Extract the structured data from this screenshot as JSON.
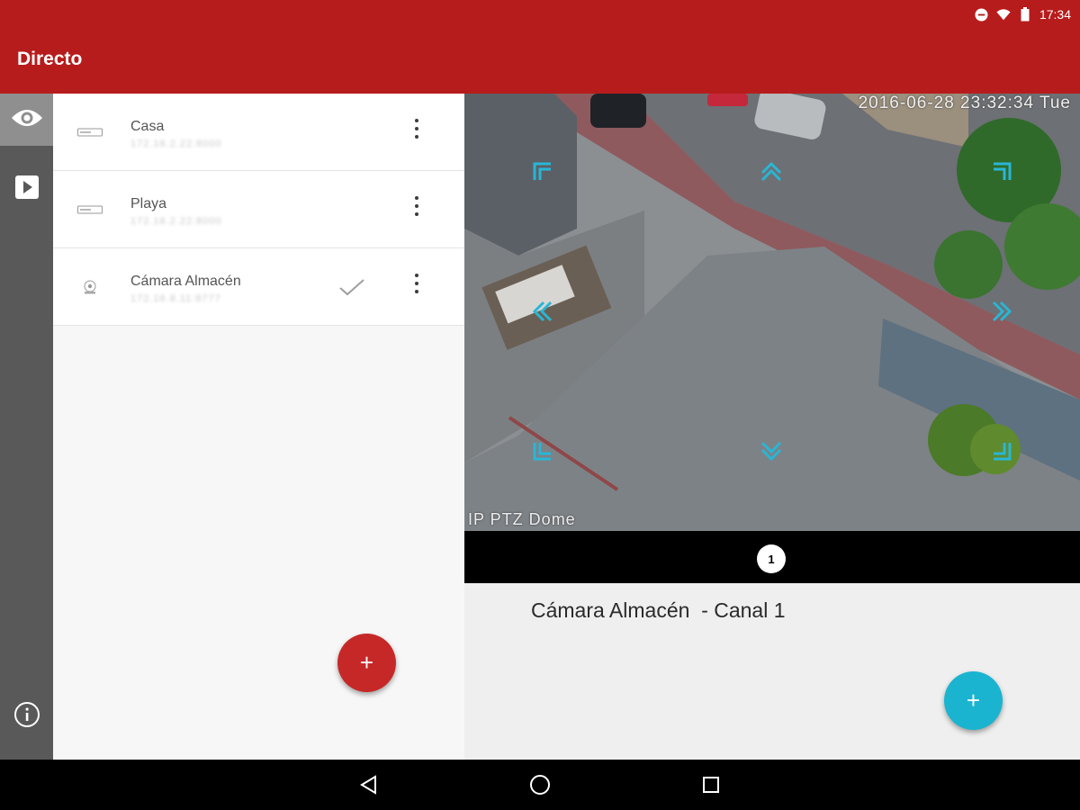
{
  "status_bar": {
    "time": "17:34",
    "icons": [
      "do-not-disturb-icon",
      "wifi-icon",
      "battery-icon"
    ]
  },
  "app_bar": {
    "title": "Directo",
    "color": "#b71c1c"
  },
  "nav_rail": {
    "items": [
      {
        "icon": "eye-icon",
        "active": true
      },
      {
        "icon": "play-icon",
        "active": false
      },
      {
        "icon": "info-icon",
        "active": false
      }
    ]
  },
  "device_list": [
    {
      "name": "Casa",
      "address": "172.16.2.22:8000",
      "icon": "dvr-icon",
      "selected": false
    },
    {
      "name": "Playa",
      "address": "172.16.2.22:8000",
      "icon": "dvr-icon",
      "selected": false
    },
    {
      "name": "Cámara Almacén",
      "address": "172.16.8.11:8777",
      "icon": "ip-camera-icon",
      "selected": true
    }
  ],
  "video": {
    "osd_timestamp": "2016-06-28 23:32:34 Tue",
    "osd_camera_name": "IP PTZ Dome",
    "ptz_color": "#29b6d6"
  },
  "pager": {
    "current": "1"
  },
  "channel_info": {
    "title": "Cámara Almacén  - Canal 1"
  },
  "fab": {
    "add_device": "+",
    "add_channel": "+",
    "red": "#c62828",
    "cyan": "#1ab4d0"
  },
  "system_nav": {
    "buttons": [
      "back-icon",
      "home-icon",
      "recents-icon"
    ]
  }
}
